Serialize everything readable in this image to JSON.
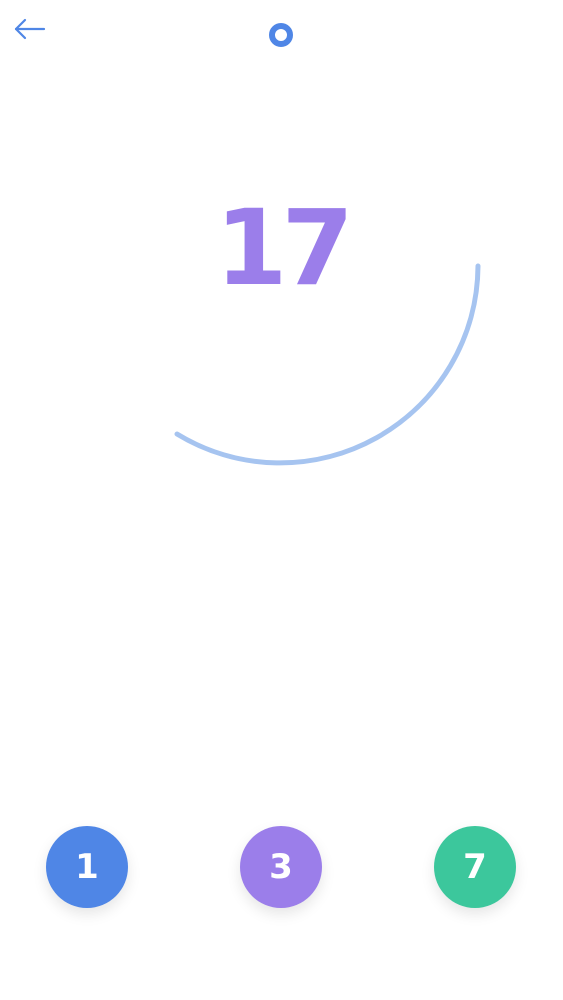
{
  "header": {
    "back_icon": "arrow-left-icon",
    "status_icon": "ring-dot-icon",
    "accent_color": "#4f86e6"
  },
  "target": {
    "value": "17",
    "color": "#9b7eea",
    "timer_progress": 0.5,
    "timer_color": "#a6c4f0"
  },
  "choices": [
    {
      "label": "1",
      "color": "#4f86e6"
    },
    {
      "label": "3",
      "color": "#9b7eea"
    },
    {
      "label": "7",
      "color": "#3cc79c"
    }
  ]
}
